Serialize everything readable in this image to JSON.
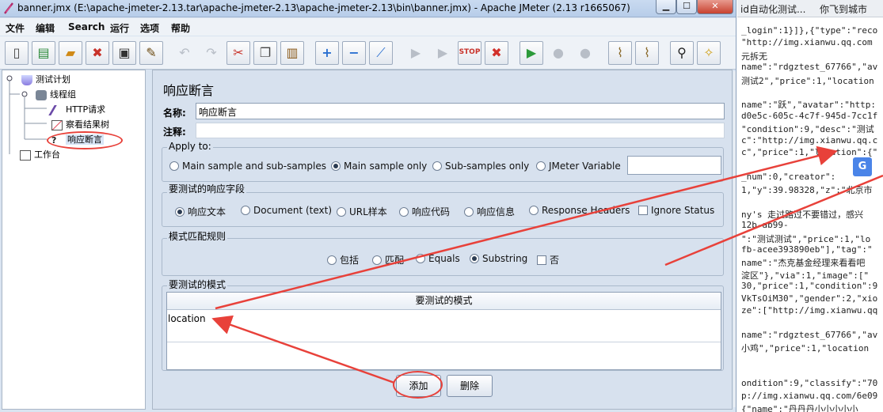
{
  "window": {
    "title": "banner.jmx (E:\\apache-jmeter-2.13.tar\\apache-jmeter-2.13\\apache-jmeter-2.13\\bin\\banner.jmx) - Apache JMeter (2.13 r1665067)",
    "minimize": "▁",
    "maximize": "☐",
    "close": "✕"
  },
  "menu": [
    "文件",
    "编辑",
    "Search",
    "运行",
    "选项",
    "帮助"
  ],
  "toolbar_icons": [
    "new-icon",
    "templates-icon",
    "open-icon",
    "close-file-icon",
    "save-icon",
    "save-as-icon",
    "undo-icon",
    "redo-icon",
    "cut-icon",
    "copy-icon",
    "paste-icon",
    "expand-icon",
    "collapse-icon",
    "toggle-icon",
    "start-icon",
    "start-no-pause-icon",
    "stop-icon",
    "shutdown-icon",
    "remote-start-icon",
    "remote-stop-icon",
    "remote-shutdown-icon",
    "clear-icon",
    "clear-all-icon",
    "search-icon",
    "reset-search-icon"
  ],
  "tree": {
    "test_plan": "测试计划",
    "thread_group": "线程组",
    "http_request": "HTTP请求",
    "view_results": "察看结果树",
    "assertion": "响应断言",
    "workbench": "工作台"
  },
  "panel": {
    "heading": "响应断言",
    "name_label": "名称:",
    "name_value": "响应断言",
    "comment_label": "注释:",
    "comment_value": "",
    "apply_to": {
      "title": "Apply to:",
      "options": [
        "Main sample and sub-samples",
        "Main sample only",
        "Sub-samples only",
        "JMeter Variable"
      ],
      "selected": 1,
      "variable_value": ""
    },
    "field_to_test": {
      "title": "要测试的响应字段",
      "options": [
        "响应文本",
        "Document (text)",
        "URL样本",
        "响应代码",
        "响应信息",
        "Response Headers"
      ],
      "selected": 0,
      "ignore_status": "Ignore Status"
    },
    "pattern_rules": {
      "title": "模式匹配规则",
      "options": [
        "包括",
        "匹配",
        "Equals",
        "Substring"
      ],
      "selected": 3,
      "not_label": "否"
    },
    "patterns": {
      "title": "要测试的模式",
      "column": "要测试的模式",
      "rows": [
        "location"
      ]
    },
    "add_button": "添加",
    "delete_button": "删除"
  },
  "background": {
    "tabs": [
      "id自动化测试...",
      "你飞到城市"
    ],
    "lines": [
      "_login\":1}]},{\"type\":\"reco",
      "\"http://img.xianwu.qq.com",
      "元拆无",
      "name\":\"rdgztest_67766\",\"av",
      "测试2\",\"price\":1,\"location",
      "",
      "name\":\"跃\",\"avatar\":\"http:",
      "d0e5c-605c-4c7f-945d-7cc1f",
      "\"condition\":9,\"desc\":\"测试",
      "c\":\"http://img.xianwu.qq.c",
      "c\",\"price\":1,\"location\":{\"",
      "",
      "_num\":0,\"creator\":",
      "1,\"y\":39.98328,\"z\":\"北京市",
      "",
      "ny's 走过路过不要错过，感兴",
      "12b-ab99-",
      "\":\"测试测试\",\"price\":1,\"lo",
      "fb-acee393890eb\"],\"tag\":\"",
      "name\":\"杰克基金经理来看看吧",
      "淀区\"},\"via\":1,\"image\":[\"",
      "30,\"price\":1,\"condition\":9",
      "VkTsOiM30\",\"gender\":2,\"xio",
      "ze\":[\"http://img.xianwu.qq",
      "",
      "name\":\"rdgztest_67766\",\"av",
      "小鸡\",\"price\":1,\"location",
      "",
      "",
      "ondition\":9,\"classify\":\"70",
      "p://img.xianwu.qq.com/6e09",
      "{\"name\":\"丹丹丹小小小小小"
    ]
  },
  "colors": {
    "accent_red": "#e8413a",
    "window_bg": "#d7e1ee"
  }
}
